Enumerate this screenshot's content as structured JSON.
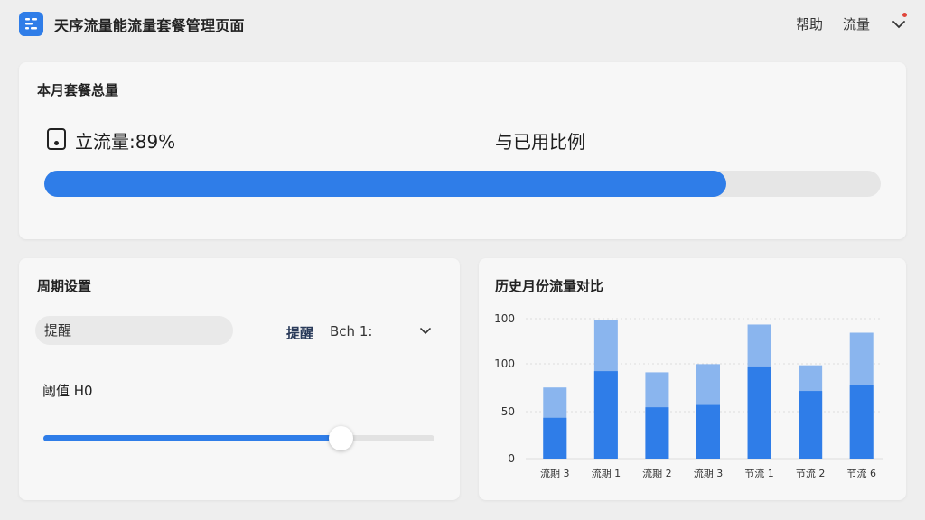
{
  "header": {
    "title": "天序流量能流量套餐管理页面",
    "nav": [
      "帮助",
      "流量"
    ]
  },
  "usage_card": {
    "title": "本月套餐总量",
    "usage_label": "立流量:89%",
    "ratio_label": "与已用比例",
    "progress": 0.815,
    "accent": "#2f7de8"
  },
  "cycle_card": {
    "title": "周期设置",
    "reminder_input_value": "提醒",
    "reminder_label": "提醒",
    "reminder_select_value": "Bch 1:",
    "threshold_label": "阈值 H0",
    "slider_value": 0.76
  },
  "history_card": {
    "title": "历史月份流量对比"
  },
  "chart_data": {
    "type": "bar",
    "title": "历史月份流量对比",
    "categories": [
      "流期 3",
      "流期 1",
      "流期 2",
      "流期 3",
      "节流 1",
      "节流 2",
      "节流 6"
    ],
    "series": [
      {
        "name": "",
        "values": [
          35,
          75,
          44,
          46,
          79,
          58,
          63
        ],
        "color": "#2f7de8"
      },
      {
        "name": "",
        "values": [
          61,
          119,
          74,
          81,
          115,
          80,
          108
        ],
        "color": "#8ab5ee"
      }
    ],
    "yticks": [
      100,
      100,
      50,
      0
    ],
    "ylim": [
      0,
      120
    ],
    "grid": true
  }
}
